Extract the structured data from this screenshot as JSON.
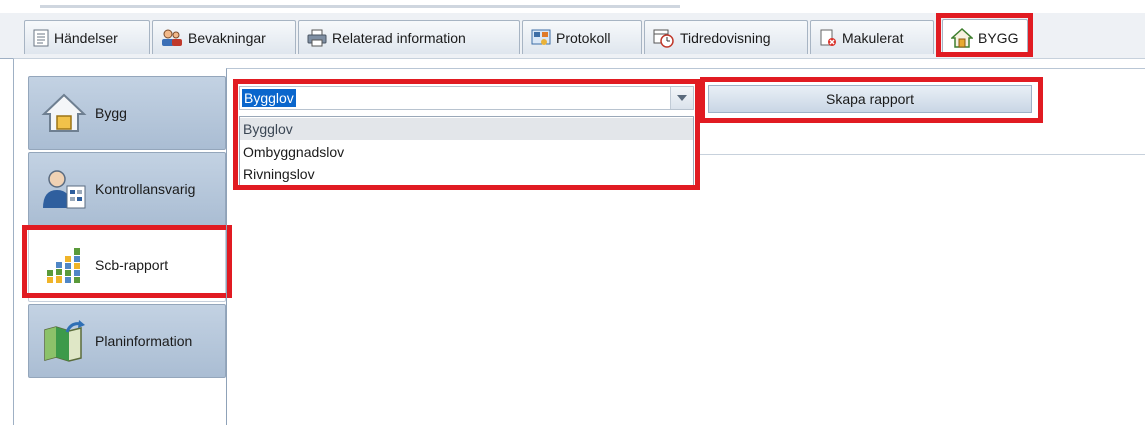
{
  "tabs": [
    {
      "label": "Händelser",
      "icon": "document-list-icon"
    },
    {
      "label": "Bevakningar",
      "icon": "users-icon"
    },
    {
      "label": "Relaterad information",
      "icon": "printer-icon"
    },
    {
      "label": "Protokoll",
      "icon": "protocol-icon"
    },
    {
      "label": "Tidredovisning",
      "icon": "calendar-clock-icon"
    },
    {
      "label": "Makulerat",
      "icon": "cancelled-document-icon"
    },
    {
      "label": "BYGG",
      "icon": "house-icon",
      "active": true
    }
  ],
  "sidebar": {
    "items": [
      {
        "label": "Bygg",
        "icon": "house-icon"
      },
      {
        "label": "Kontrollansvarig",
        "icon": "inspector-icon"
      },
      {
        "label": "Scb-rapport",
        "icon": "bar-chart-icon",
        "selected": true
      },
      {
        "label": "Planinformation",
        "icon": "plan-map-icon"
      }
    ]
  },
  "report": {
    "combo_value": "Bygglov",
    "options": [
      "Bygglov",
      "Ombyggnadslov",
      "Rivningslov"
    ],
    "selected_option": "Bygglov",
    "create_button_label": "Skapa rapport"
  },
  "colors": {
    "highlight": "#e11b22",
    "selection": "#0a66cc"
  }
}
